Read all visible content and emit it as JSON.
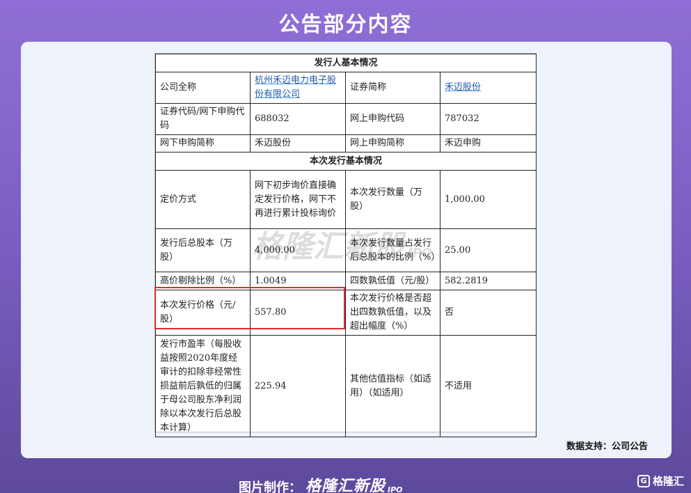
{
  "header": {
    "title": "公告部分内容"
  },
  "document": {
    "section1_title": "发行人基本情况",
    "row1": {
      "l1": "公司全称",
      "v1": "杭州禾迈电力电子股份有限公司",
      "l2": "证券简称",
      "v2": "禾迈股份"
    },
    "row2": {
      "l1": "证券代码/网下申购代码",
      "v1": "688032",
      "l2": "网上申购代码",
      "v2": "787032"
    },
    "row3": {
      "l1": "网下申购简称",
      "v1": "禾迈股份",
      "l2": "网上申购简称",
      "v2": "禾迈申购"
    },
    "section2_title": "本次发行基本情况",
    "row4": {
      "l1": "定价方式",
      "v1": "网下初步询价直接确定发行价格，网下不再进行累计投标询价",
      "l2": "本次发行数量（万股）",
      "v2": "1,000.00"
    },
    "row5": {
      "l1": "发行后总股本（万股）",
      "v1": "4,000.00",
      "l2": "本次发行数量占发行后总股本的比例（%）",
      "v2": "25.00"
    },
    "row6": {
      "l1": "高价剔除比例（%）",
      "v1": "1.0049",
      "l2": "四数孰低值（元/股）",
      "v2": "582.2819"
    },
    "row7": {
      "l1": "本次发行价格（元/股）",
      "v1": "557.80",
      "l2": "本次发行价格是否超出四数孰低值，以及超出幅度（%）",
      "v2": "否"
    },
    "row8": {
      "l1": "发行市盈率（每股收益按照2020年度经审计的扣除非经常性损益前后孰低的归属于母公司股东净利润除以本次发行后总股本计算）",
      "v1": "225.94",
      "l2": "其他估值指标（如适用）（如适用）",
      "v2": "不适用"
    }
  },
  "watermark": {
    "text": "格隆汇新股",
    "suffix": "IPO"
  },
  "source_note": "数据支持：公司公告",
  "footer": {
    "maker_label": "图片制作：",
    "brand": "格隆汇新股",
    "brand_suffix": "IPO",
    "logo_mark": "G",
    "logo_text": "格隆汇"
  },
  "colors": {
    "highlight": "#e02a2a",
    "link": "#1f5aa6",
    "background_top": "#8f6fd6"
  }
}
